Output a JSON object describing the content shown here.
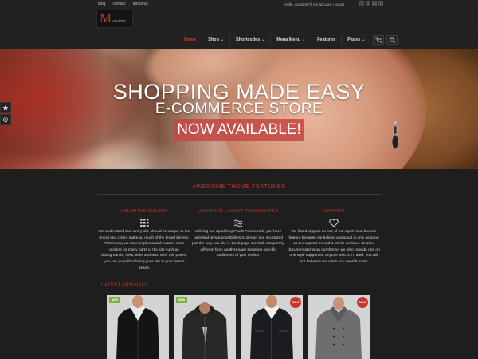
{
  "header": {
    "top_links": [
      "blog",
      "contact",
      "about us"
    ],
    "account_text": "[Hello, spadmin!?] my account | logout",
    "social_icons": [
      "facebook-icon",
      "twitter-icon",
      "linkedin-icon",
      "rss-icon"
    ],
    "logo_initial": "M",
    "logo_rest": "assimo"
  },
  "nav": {
    "items": [
      {
        "label": "Home",
        "active": true,
        "has_caret": false
      },
      {
        "label": "Shop",
        "active": false,
        "has_caret": true
      },
      {
        "label": "Shortcodes",
        "active": false,
        "has_caret": true
      },
      {
        "label": "Mega Menu",
        "active": false,
        "has_caret": true
      },
      {
        "label": "Features",
        "active": false,
        "has_caret": false
      },
      {
        "label": "Pages",
        "active": false,
        "has_caret": true
      }
    ],
    "cart_icon": "cart-icon",
    "search_icon": "search-icon"
  },
  "hero": {
    "headline": "SHOPPING MADE EASY",
    "subheadline": "E-COMMERCE STORE",
    "cta": "NOW AVAILABLE!"
  },
  "side_tabs": [
    "star-icon",
    "gear-icon"
  ],
  "features": {
    "title": "AWESOME THEME FEATURES",
    "items": [
      {
        "title": "UNLIMITED COLORS",
        "icon": "grid-icon",
        "lines": [
          "We understand that every site should be unique to the",
          "brand and colors make up much of the brand identity.",
          "This is why we have implemented custom color",
          "pickers for many parts of the site such as",
          "backgrounds, links, titles and text. With this power,",
          "you can go wild coloring your site to your hearts",
          "desire."
        ]
      },
      {
        "title": "UNLIMITED LAYOUT POSSIBILITIES",
        "icon": "waves-icon",
        "lines": [
          "Utilizing our Splashing Pixels Framework, you have",
          "unlimited layout possibilities to design and structured",
          "just the way you like it. Each page can look completely",
          "different from another page targeting specific",
          "audiences of your choice."
        ]
      },
      {
        "title": "SUPPORT",
        "icon": "heart-icon",
        "lines": [
          "We listed support as one of our top 3 most favorite",
          "feature because we believe a product is only as good",
          "as the support behind it. While we have detailed",
          "documentations on our theme, we also provide one on",
          "one style support for anyone who is in need. You will",
          "not be leave out when you need it most!"
        ]
      }
    ]
  },
  "arrivals": {
    "title": "LATEST ARRIVALS",
    "products": [
      {
        "badge": "NEW",
        "badge_type": "new",
        "jacket_color": "#141414"
      },
      {
        "badge": "NEW",
        "badge_type": "new",
        "jacket_color": "#2a2826"
      },
      {
        "badge": "SALE",
        "badge_type": "sale",
        "jacket_color": "#1a1c22"
      },
      {
        "badge": "SALE",
        "badge_type": "sale",
        "jacket_color": "#6e6e70"
      }
    ]
  },
  "colors": {
    "accent": "#c9342e",
    "new_badge": "#7db043",
    "background": "#1e1e1e"
  }
}
